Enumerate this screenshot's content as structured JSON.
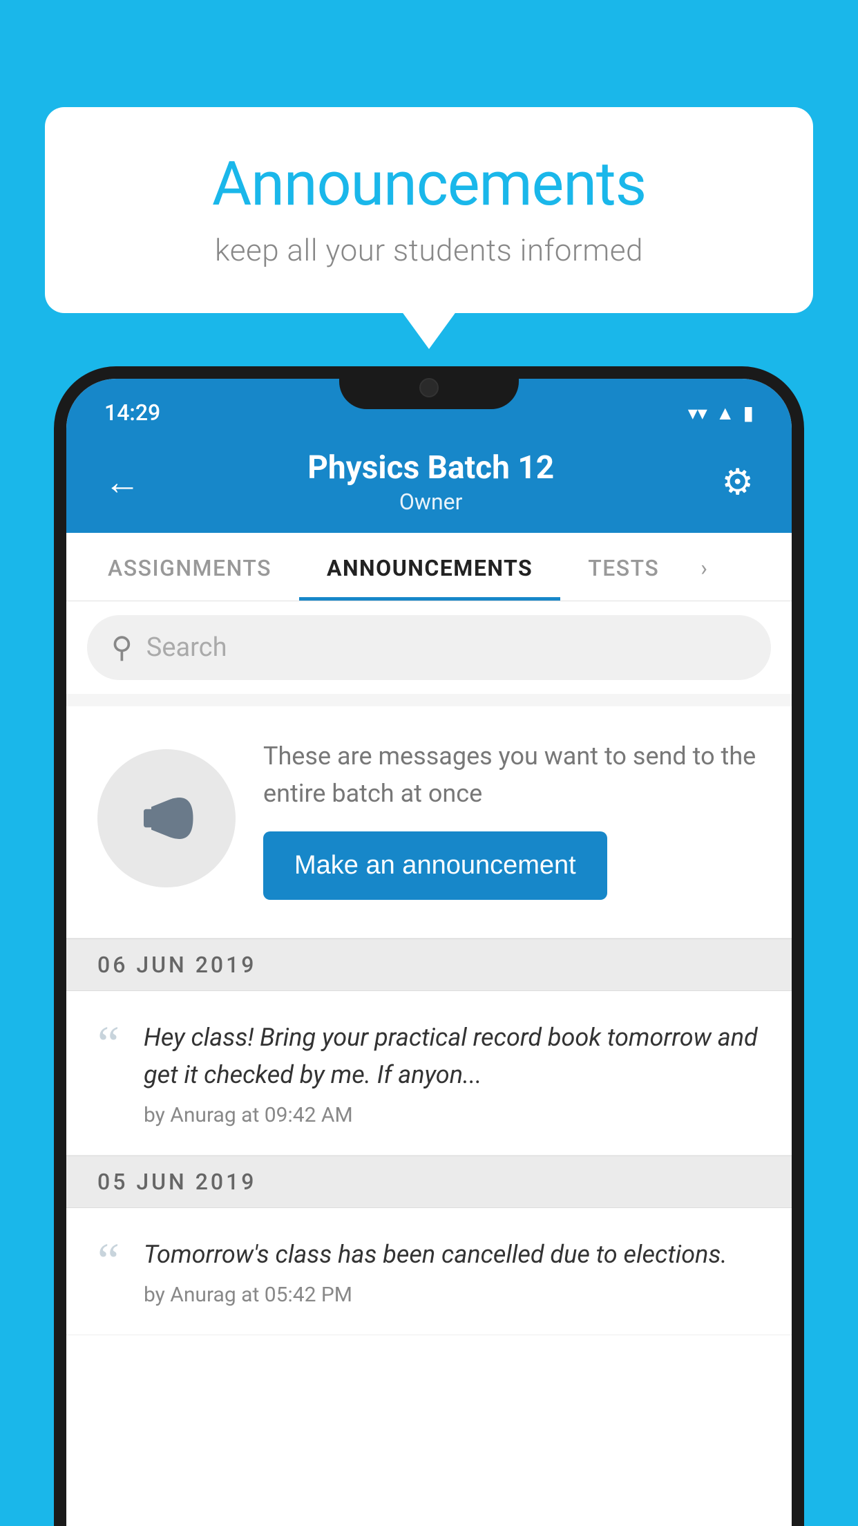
{
  "background_color": "#1ab7ea",
  "speech_bubble": {
    "title": "Announcements",
    "subtitle": "keep all your students informed"
  },
  "status_bar": {
    "time": "14:29",
    "icons": [
      "wifi",
      "signal",
      "battery"
    ]
  },
  "header": {
    "title": "Physics Batch 12",
    "subtitle": "Owner",
    "back_label": "←",
    "gear_label": "⚙"
  },
  "tabs": [
    {
      "label": "ASSIGNMENTS",
      "active": false
    },
    {
      "label": "ANNOUNCEMENTS",
      "active": true
    },
    {
      "label": "TESTS",
      "active": false
    }
  ],
  "search": {
    "placeholder": "Search"
  },
  "promo_card": {
    "description": "These are messages you want to send to the entire batch at once",
    "button_label": "Make an announcement"
  },
  "date_separators": [
    {
      "label": "06  JUN  2019"
    },
    {
      "label": "05  JUN  2019"
    }
  ],
  "announcements": [
    {
      "text": "Hey class! Bring your practical record book tomorrow and get it checked by me. If anyon...",
      "meta": "by Anurag at 09:42 AM"
    },
    {
      "text": "Tomorrow's class has been cancelled due to elections.",
      "meta": "by Anurag at 05:42 PM"
    }
  ]
}
